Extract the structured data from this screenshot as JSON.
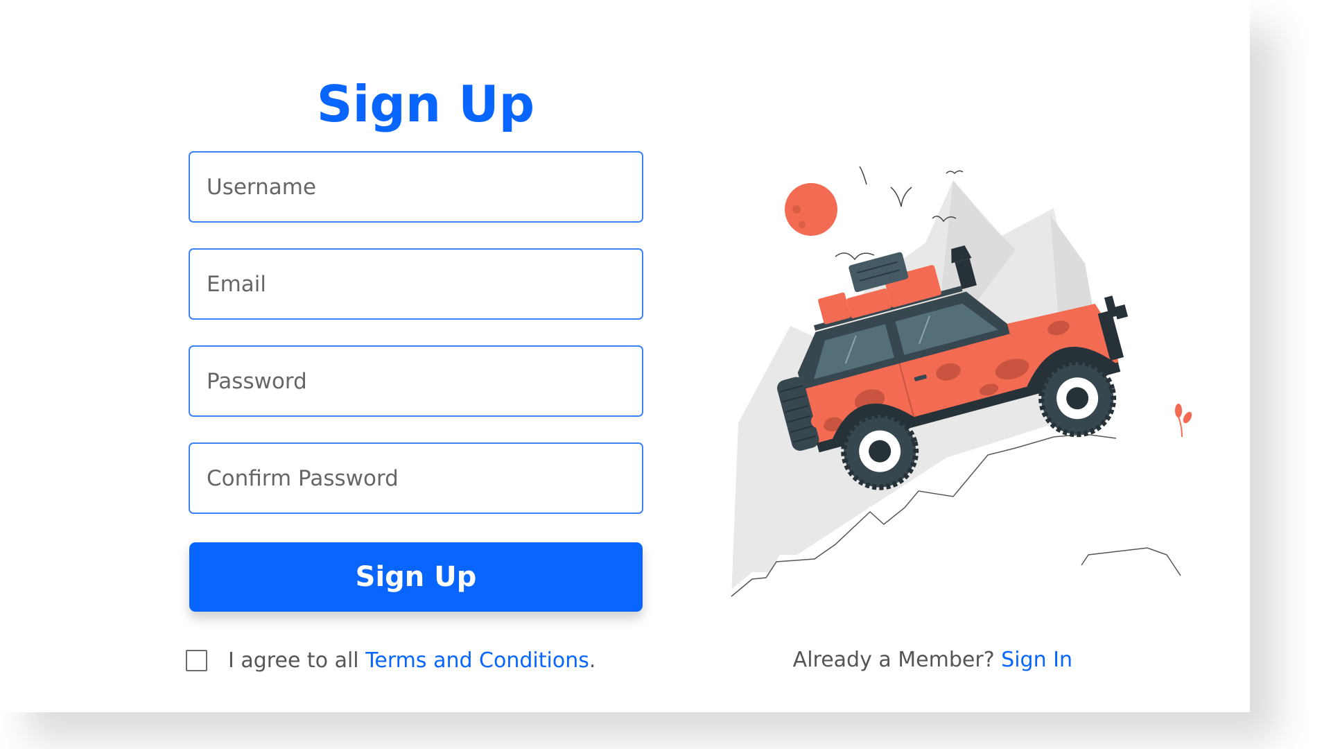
{
  "signup": {
    "title": "Sign Up",
    "fields": [
      {
        "placeholder": "Username"
      },
      {
        "placeholder": "Email"
      },
      {
        "placeholder": "Password"
      },
      {
        "placeholder": "Confirm Password"
      }
    ],
    "submit_label": "Sign Up",
    "agree_prefix": "I agree to all ",
    "agree_link": "Terms and Conditions",
    "agree_suffix": ".",
    "member_prompt": "Already a Member? ",
    "signin_link": "Sign In"
  },
  "illustration": {
    "name": "off-road-jeep-illustration",
    "colors": {
      "primary": "#0866ff",
      "jeep_body": "#f26b52",
      "jeep_dark": "#37474f",
      "sun": "#f26b52",
      "mountains": "#e6e6e6"
    }
  }
}
